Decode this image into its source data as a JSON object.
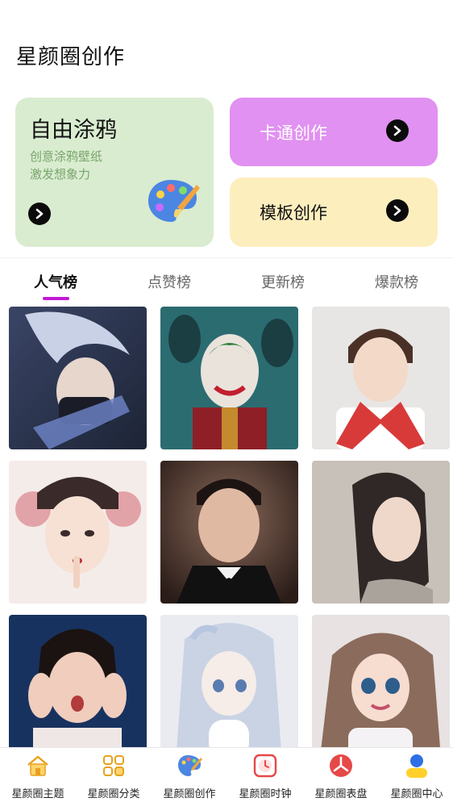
{
  "page": {
    "title": "星颜圈创作"
  },
  "cards": {
    "doodle": {
      "title": "自由涂鸦",
      "line1": "创意涂鸦壁纸",
      "line2": "激发想象力"
    },
    "cartoon": {
      "label": "卡通创作"
    },
    "template": {
      "label": "模板创作"
    }
  },
  "tabs": [
    {
      "label": "人气榜",
      "active": true
    },
    {
      "label": "点赞榜",
      "active": false
    },
    {
      "label": "更新榜",
      "active": false
    },
    {
      "label": "爆款榜",
      "active": false
    }
  ],
  "gallery": [
    {
      "name": "silver-hair-masked-warrior",
      "colors": [
        "#3f4a6e",
        "#9aa7c7"
      ]
    },
    {
      "name": "joker-poster",
      "colors": [
        "#2a6b6e",
        "#9b2b2b"
      ]
    },
    {
      "name": "boy-red-scarf",
      "colors": [
        "#e7e5e3",
        "#d63a3a"
      ]
    },
    {
      "name": "qing-dynasty-lady",
      "colors": [
        "#f3e9e6",
        "#d88d8d"
      ]
    },
    {
      "name": "man-in-tuxedo",
      "colors": [
        "#3a2a26",
        "#8a6a5a"
      ]
    },
    {
      "name": "long-hair-woman",
      "colors": [
        "#c8c2ba",
        "#3a3330"
      ]
    },
    {
      "name": "surprised-girl",
      "colors": [
        "#1b3b6e",
        "#e8c4b4"
      ]
    },
    {
      "name": "anime-white-hair-girl",
      "colors": [
        "#e7e9ef",
        "#a9b6cf"
      ]
    },
    {
      "name": "3d-princess",
      "colors": [
        "#e9e4e4",
        "#8a6b5a"
      ]
    }
  ],
  "tabbar": [
    {
      "label": "星颜圈主题",
      "icon": "home-icon"
    },
    {
      "label": "星颜圈分类",
      "icon": "category-grid-icon"
    },
    {
      "label": "星颜圈创作",
      "icon": "palette-icon"
    },
    {
      "label": "星颜圈时钟",
      "icon": "clock-icon"
    },
    {
      "label": "星颜圈表盘",
      "icon": "watch-dial-icon"
    },
    {
      "label": "星颜圈中心",
      "icon": "profile-icon"
    }
  ],
  "colors": {
    "doodle_bg": "#d9ecd0",
    "cartoon_bg": "#e191f1",
    "template_bg": "#fdeebe",
    "tab_underline": "#c01ad4",
    "doodle_sub": "#7aa56c"
  }
}
